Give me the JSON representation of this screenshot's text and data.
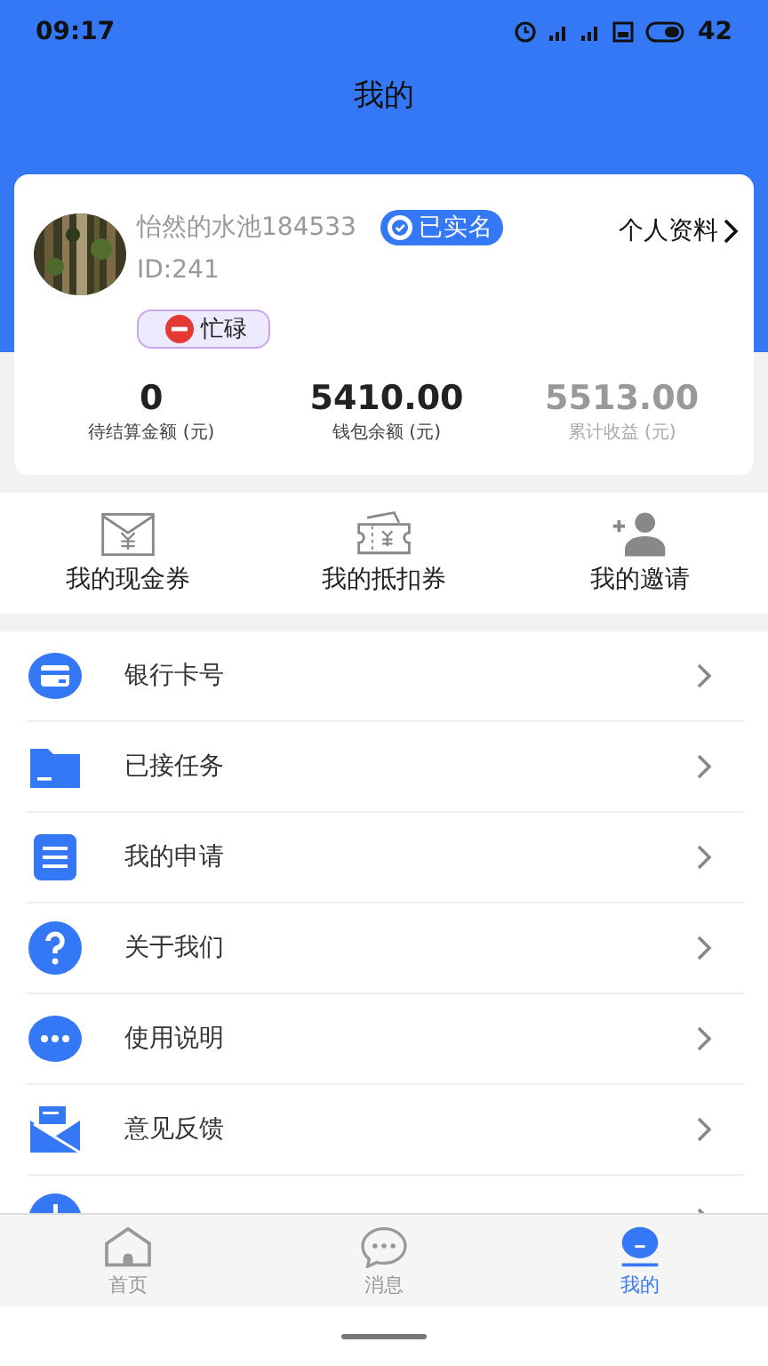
{
  "status_bar": {
    "time": "09:17",
    "battery": "42"
  },
  "header": {
    "title": "我的"
  },
  "profile": {
    "name": "怡然的水池184533",
    "id": "ID:241",
    "verified_badge": "已实名",
    "profile_link": "个人资料",
    "status": "忙碌"
  },
  "stats": [
    {
      "value": "0",
      "label": "待结算金额 (元)",
      "dimmed": false
    },
    {
      "value": "5410.00",
      "label": "钱包余额 (元)",
      "dimmed": false
    },
    {
      "value": "5513.00",
      "label": "累计收益 (元)",
      "dimmed": true
    }
  ],
  "shortcuts": [
    {
      "kind": "envelope",
      "label": "我的现金券"
    },
    {
      "kind": "ticket",
      "label": "我的抵扣券"
    },
    {
      "kind": "invite",
      "label": "我的邀请"
    }
  ],
  "menu": [
    {
      "kind": "card",
      "label": "银行卡号"
    },
    {
      "kind": "folder",
      "label": "已接任务"
    },
    {
      "kind": "list",
      "label": "我的申请"
    },
    {
      "kind": "question",
      "label": "关于我们"
    },
    {
      "kind": "more",
      "label": "使用说明"
    },
    {
      "kind": "mail",
      "label": "意见反馈"
    },
    {
      "kind": "power"
    }
  ],
  "tab_bar": [
    {
      "kind": "home",
      "label": "首页",
      "selected": false
    },
    {
      "kind": "chat",
      "label": "消息",
      "selected": false
    },
    {
      "kind": "me",
      "label": "我的",
      "selected": true
    }
  ]
}
